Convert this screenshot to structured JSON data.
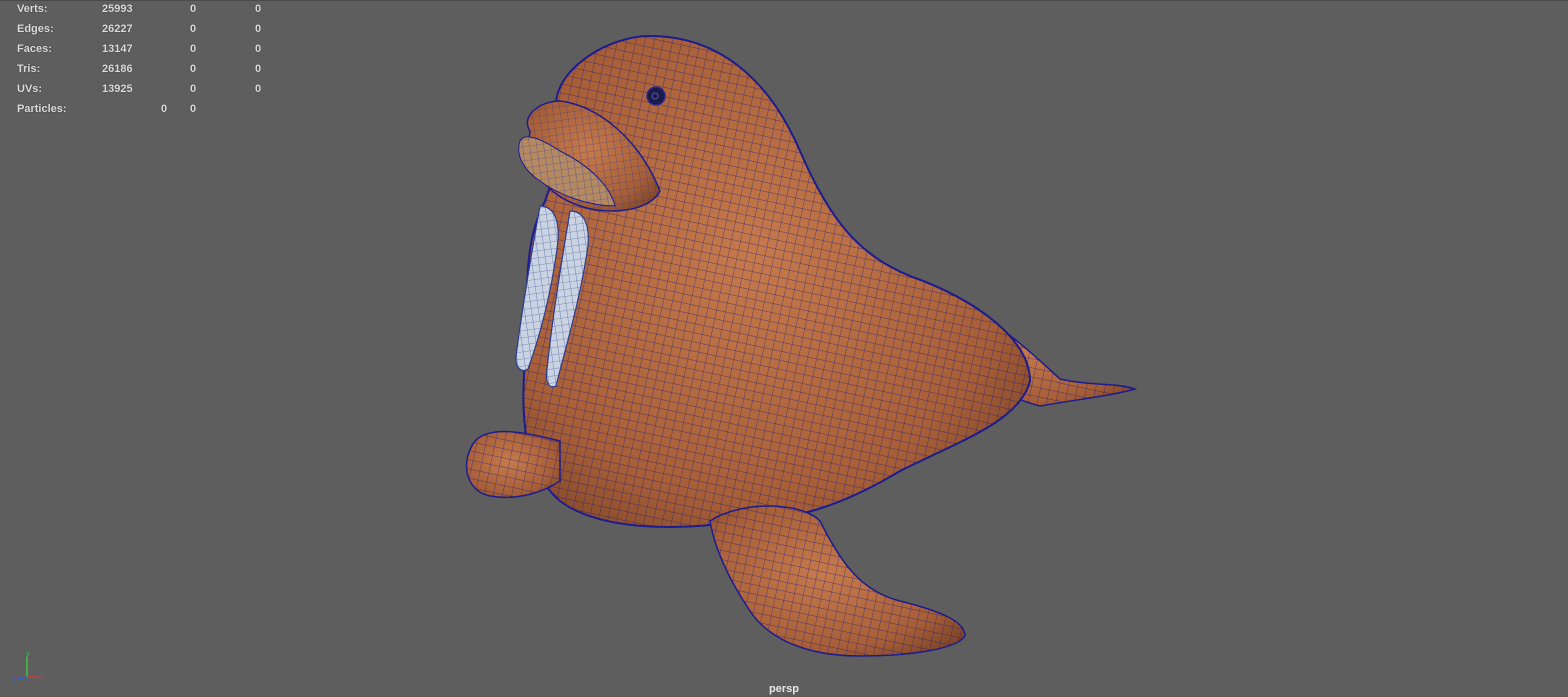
{
  "hud": {
    "rows": [
      {
        "label": "Verts:",
        "v1": "25993",
        "v2": "0",
        "v3": "0"
      },
      {
        "label": "Edges:",
        "v1": "26227",
        "v2": "0",
        "v3": "0"
      },
      {
        "label": "Faces:",
        "v1": "13147",
        "v2": "0",
        "v3": "0"
      },
      {
        "label": "Tris:",
        "v1": "26186",
        "v2": "0",
        "v3": "0"
      },
      {
        "label": "UVs:",
        "v1": "13925",
        "v2": "0",
        "v3": "0"
      }
    ],
    "particles": {
      "label": "Particles:",
      "v1": "0",
      "v2": "0"
    }
  },
  "viewport": {
    "camera": "persp",
    "background_color": "#5e5e5e",
    "model": {
      "subject": "walrus",
      "body_color": "#b5683f",
      "wire_color": "#1a1a8c",
      "tusk_color": "#c9d3e2"
    },
    "axis_gizmo": {
      "icon": "axis-gizmo-icon",
      "x_label": "x",
      "y_label": "y",
      "z_label": "z"
    }
  }
}
